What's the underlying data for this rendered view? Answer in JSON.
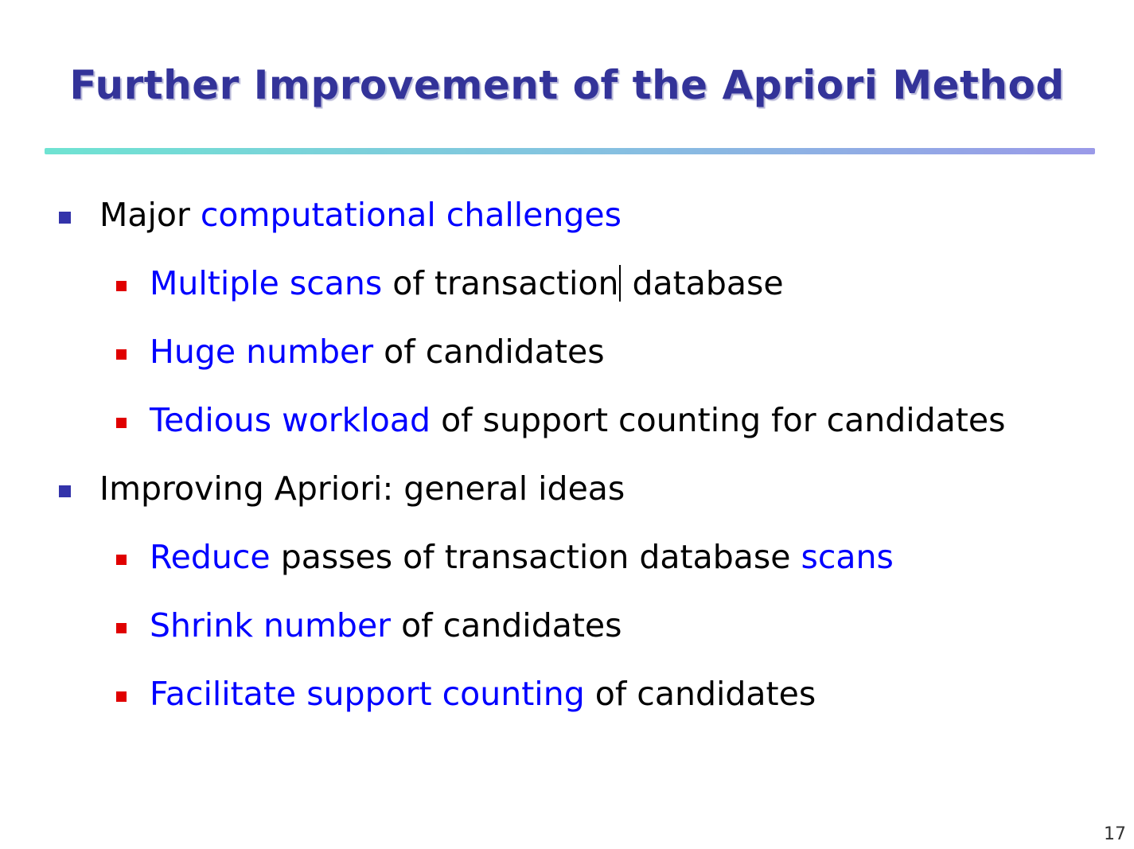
{
  "slide": {
    "title": "Further Improvement of the Apriori Method",
    "page_number": "17",
    "bullets": [
      {
        "level": 1,
        "segments": [
          {
            "text": "Major ",
            "highlight": false
          },
          {
            "text": "computational challenges",
            "highlight": true
          }
        ]
      },
      {
        "level": 2,
        "segments": [
          {
            "text": "Multiple scans",
            "highlight": true
          },
          {
            "text": " of transaction",
            "highlight": false,
            "cursor_after": true
          },
          {
            "text": " database",
            "highlight": false
          }
        ]
      },
      {
        "level": 2,
        "segments": [
          {
            "text": "Huge number",
            "highlight": true
          },
          {
            "text": " of candidates",
            "highlight": false
          }
        ]
      },
      {
        "level": 2,
        "segments": [
          {
            "text": "Tedious workload",
            "highlight": true
          },
          {
            "text": " of support counting for candidates",
            "highlight": false
          }
        ]
      },
      {
        "level": 1,
        "segments": [
          {
            "text": "Improving Apriori: general ideas",
            "highlight": false
          }
        ]
      },
      {
        "level": 2,
        "segments": [
          {
            "text": "Reduce",
            "highlight": true
          },
          {
            "text": " passes of transaction database ",
            "highlight": false
          },
          {
            "text": "scans",
            "highlight": true
          }
        ]
      },
      {
        "level": 2,
        "segments": [
          {
            "text": "Shrink number",
            "highlight": true
          },
          {
            "text": " of candidates",
            "highlight": false
          }
        ]
      },
      {
        "level": 2,
        "segments": [
          {
            "text": "Facilitate support counting",
            "highlight": true
          },
          {
            "text": " of candidates",
            "highlight": false
          }
        ]
      }
    ]
  },
  "colors": {
    "title": "#333399",
    "highlight": "#0000ff",
    "body_text": "#000000",
    "level1_marker": "#3333aa",
    "level2_marker": "#e00000"
  }
}
